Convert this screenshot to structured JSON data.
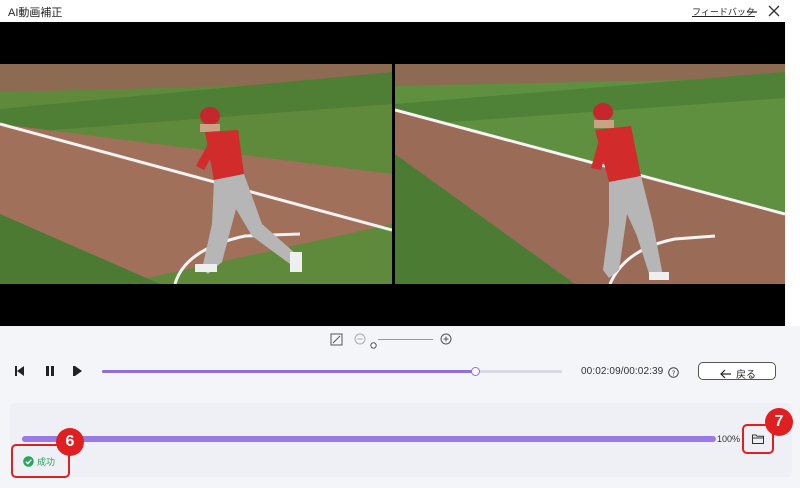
{
  "window": {
    "title": "AI動画補正",
    "feedback_link": "フィードバック"
  },
  "player": {
    "time_display": "00:02:09/00:02:39",
    "playback_progress": 0.81,
    "back_label": "戻る"
  },
  "export": {
    "progress": 1.0,
    "progress_text": "100%",
    "status_text": "成功"
  },
  "callouts": {
    "status": "6",
    "folder": "7"
  },
  "colors": {
    "accent": "#8f6ee0",
    "success": "#2aa55b",
    "callout": "#e02020"
  },
  "icons": {
    "fit_screen": "fit-screen-icon",
    "zoom_out": "zoom-out-icon",
    "zoom_in": "zoom-in-icon",
    "prev_frame": "prev-frame-icon",
    "pause": "pause-icon",
    "next_frame": "next-frame-icon",
    "help": "help-icon",
    "back_arrow": "back-arrow-icon",
    "folder": "folder-icon",
    "success": "check-circle-icon"
  }
}
